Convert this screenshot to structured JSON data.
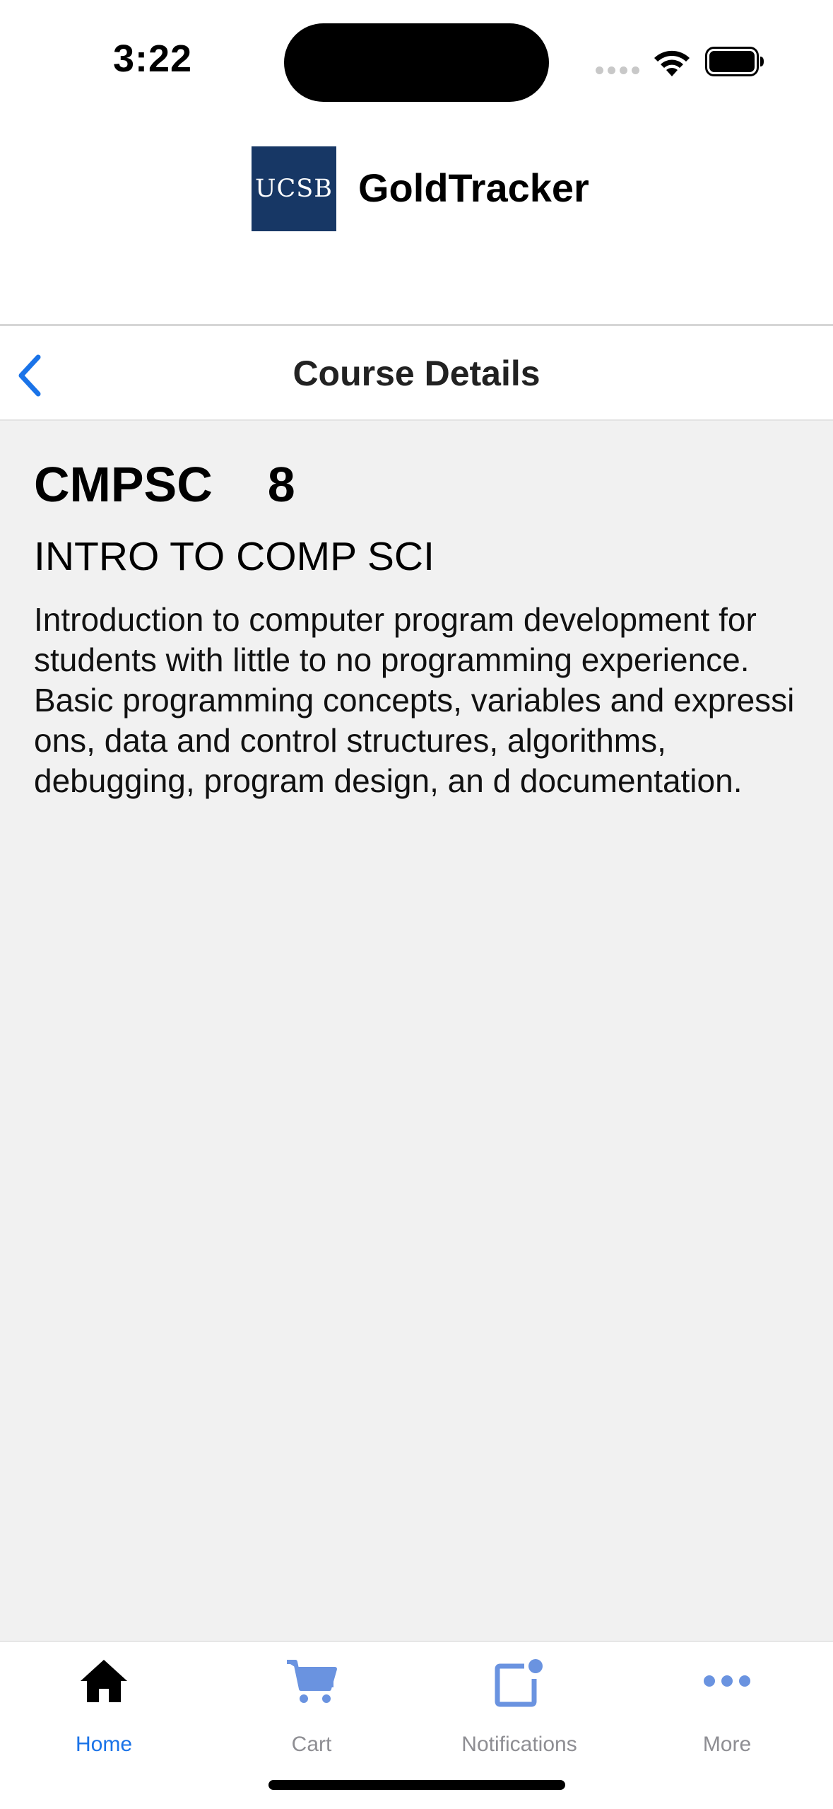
{
  "status_bar": {
    "time": "3:22",
    "signal_icon": "signal-dots-icon",
    "wifi_icon": "wifi-icon",
    "battery_icon": "battery-icon"
  },
  "app_header": {
    "logo_text": "UCSB",
    "title": "GoldTracker",
    "logo_color": "#173765"
  },
  "nav": {
    "back_icon": "chevron-left-icon",
    "title": "Course Details",
    "accent_color": "#1a73e8"
  },
  "course": {
    "subject": "CMPSC",
    "number": "8",
    "title": "INTRO TO COMP SCI",
    "description": "Introduction to computer program development for students with little to no programming experience. Basic programming concepts, variables and expressi ons, data and control structures, algorithms, debugging, program design, an d documentation."
  },
  "tab_bar": {
    "tabs": [
      {
        "label": "Home",
        "icon": "home-icon",
        "active": true
      },
      {
        "label": "Cart",
        "icon": "cart-icon",
        "active": false
      },
      {
        "label": "Notifications",
        "icon": "notifications-icon",
        "active": false
      },
      {
        "label": "More",
        "icon": "more-icon",
        "active": false
      }
    ]
  }
}
